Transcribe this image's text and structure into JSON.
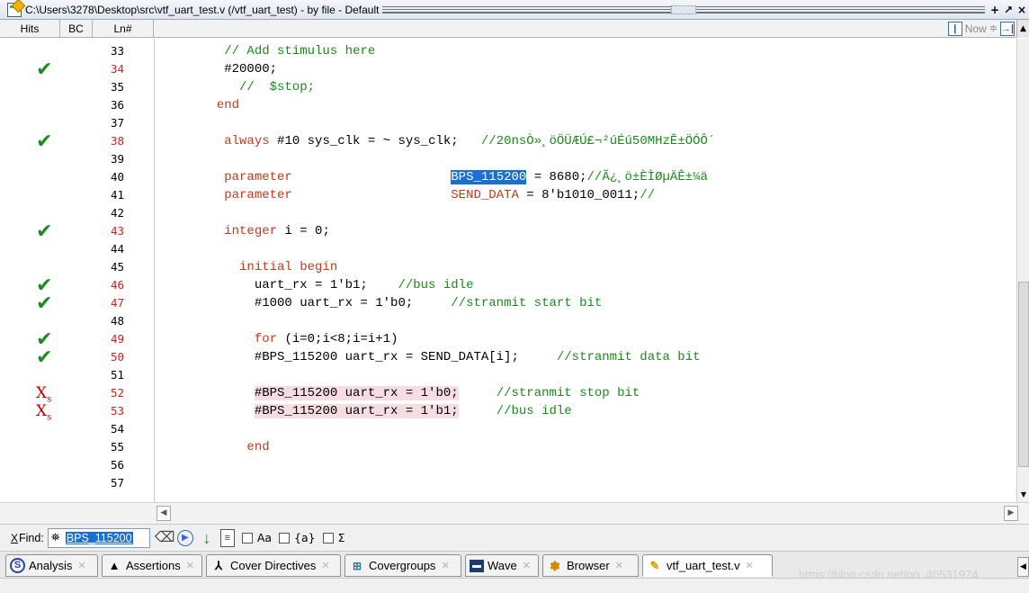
{
  "window": {
    "title": "C:\\Users\\3278\\Desktop\\src\\vtf_uart_test.v (/vtf_uart_test) - by file - Default",
    "buttons": [
      "+",
      "↗",
      "×"
    ]
  },
  "header": {
    "columns": [
      "Hits",
      "BC",
      "Ln#"
    ],
    "now_label": "Now"
  },
  "code": {
    "lines": [
      {
        "ln": "33",
        "hit": "",
        "segs": [
          {
            "t": "        ",
            "c": ""
          },
          {
            "t": "// Add stimulus here",
            "c": "cm"
          }
        ]
      },
      {
        "ln": "34",
        "hit": "check",
        "segs": [
          {
            "t": "        #20000;",
            "c": ""
          }
        ]
      },
      {
        "ln": "35",
        "hit": "",
        "segs": [
          {
            "t": "          ",
            "c": ""
          },
          {
            "t": "//  $stop;",
            "c": "cm"
          }
        ]
      },
      {
        "ln": "36",
        "hit": "",
        "segs": [
          {
            "t": "       ",
            "c": ""
          },
          {
            "t": "end",
            "c": "kw"
          }
        ]
      },
      {
        "ln": "37",
        "hit": "",
        "segs": []
      },
      {
        "ln": "38",
        "hit": "check",
        "segs": [
          {
            "t": "        ",
            "c": ""
          },
          {
            "t": "always",
            "c": "kw"
          },
          {
            "t": " #10 sys_clk = ~ sys_clk;   ",
            "c": ""
          },
          {
            "t": "//20nsÒ»¸öÖÜÆÚ£¬²úÉú50MHzÊ±ÖÓÔ´",
            "c": "cm"
          }
        ]
      },
      {
        "ln": "39",
        "hit": "",
        "segs": []
      },
      {
        "ln": "40",
        "hit": "",
        "segs": [
          {
            "t": "        ",
            "c": ""
          },
          {
            "t": "parameter",
            "c": "kw"
          },
          {
            "t": "                     ",
            "c": ""
          },
          {
            "t": "BPS_115200",
            "c": "sel"
          },
          {
            "t": " = 8680;",
            "c": ""
          },
          {
            "t": "//Ã¿¸ö±ÈÌØµÄÊ±¼ä",
            "c": "cm"
          }
        ]
      },
      {
        "ln": "41",
        "hit": "",
        "segs": [
          {
            "t": "        ",
            "c": ""
          },
          {
            "t": "parameter",
            "c": "kw"
          },
          {
            "t": "                     ",
            "c": ""
          },
          {
            "t": "SEND_DATA",
            "c": "kw"
          },
          {
            "t": " = 8'b1010_0011;",
            "c": ""
          },
          {
            "t": "//",
            "c": "cm"
          }
        ]
      },
      {
        "ln": "42",
        "hit": "",
        "segs": []
      },
      {
        "ln": "43",
        "hit": "check",
        "segs": [
          {
            "t": "        ",
            "c": ""
          },
          {
            "t": "integer",
            "c": "kw"
          },
          {
            "t": " i = 0;",
            "c": ""
          }
        ]
      },
      {
        "ln": "44",
        "hit": "",
        "segs": []
      },
      {
        "ln": "45",
        "hit": "",
        "segs": [
          {
            "t": "          ",
            "c": ""
          },
          {
            "t": "initial begin",
            "c": "kw"
          }
        ]
      },
      {
        "ln": "46",
        "hit": "check",
        "segs": [
          {
            "t": "            uart_rx = 1'b1;    ",
            "c": ""
          },
          {
            "t": "//bus idle",
            "c": "cm"
          }
        ]
      },
      {
        "ln": "47",
        "hit": "check",
        "segs": [
          {
            "t": "            #1000 uart_rx = 1'b0;     ",
            "c": ""
          },
          {
            "t": "//stranmit start bit",
            "c": "cm"
          }
        ]
      },
      {
        "ln": "48",
        "hit": "",
        "segs": []
      },
      {
        "ln": "49",
        "hit": "check",
        "segs": [
          {
            "t": "            ",
            "c": ""
          },
          {
            "t": "for",
            "c": "kw"
          },
          {
            "t": " (i=0;i<8;i=i+1)",
            "c": ""
          }
        ]
      },
      {
        "ln": "50",
        "hit": "check",
        "segs": [
          {
            "t": "            #BPS_115200 uart_rx = SEND_DATA[i];     ",
            "c": ""
          },
          {
            "t": "//stranmit data bit",
            "c": "cm"
          }
        ]
      },
      {
        "ln": "51",
        "hit": "",
        "segs": []
      },
      {
        "ln": "52",
        "hit": "miss",
        "segs": [
          {
            "t": "            ",
            "c": ""
          },
          {
            "t": "#BPS_115200 uart_rx = 1'b0;",
            "c": "pink"
          },
          {
            "t": "     ",
            "c": ""
          },
          {
            "t": "//stranmit stop bit",
            "c": "cm"
          }
        ]
      },
      {
        "ln": "53",
        "hit": "miss",
        "segs": [
          {
            "t": "            ",
            "c": ""
          },
          {
            "t": "#BPS_115200 uart_rx = 1'b1;",
            "c": "pink"
          },
          {
            "t": "     ",
            "c": ""
          },
          {
            "t": "//bus idle",
            "c": "cm"
          }
        ]
      },
      {
        "ln": "54",
        "hit": "",
        "segs": []
      },
      {
        "ln": "55",
        "hit": "",
        "segs": [
          {
            "t": "           ",
            "c": ""
          },
          {
            "t": "end",
            "c": "kw"
          }
        ]
      },
      {
        "ln": "56",
        "hit": "",
        "segs": []
      },
      {
        "ln": "57",
        "hit": "",
        "segs": []
      }
    ]
  },
  "find": {
    "label": "Find:",
    "close": "X",
    "value": "BPS_115200",
    "options": [
      "Aa",
      "{a}",
      "Σ"
    ]
  },
  "tabs": [
    {
      "label": "Analysis",
      "icon": "analysis-icon",
      "active": false
    },
    {
      "label": "Assertions",
      "icon": "assertions-icon",
      "active": false
    },
    {
      "label": "Cover Directives",
      "icon": "cover-directives-icon",
      "active": false
    },
    {
      "label": "Covergroups",
      "icon": "covergroups-icon",
      "active": false
    },
    {
      "label": "Wave",
      "icon": "wave-icon",
      "active": false
    },
    {
      "label": "Browser",
      "icon": "browser-icon",
      "active": false
    },
    {
      "label": "vtf_uart_test.v",
      "icon": "source-file-icon",
      "active": true
    }
  ],
  "watermark": "https://blog.csdn.net/qq_40531974",
  "colors": {
    "keyword": "#c0391b",
    "comment": "#1a8a1a",
    "hit_check": "#1d8d1d",
    "miss": "#c00000",
    "selection": "#1b6fd1",
    "miss_highlight": "#f6dde4"
  }
}
